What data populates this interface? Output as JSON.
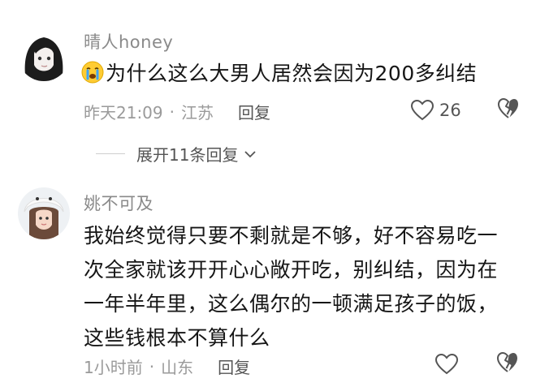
{
  "comments": [
    {
      "username": "晴人honey",
      "emoji": "crying-face-emoji",
      "text": "为什么这么大男人居然会因为200多纠结",
      "time": "昨天21:09",
      "location": "江苏",
      "reply_label": "回复",
      "likes": "26",
      "expand_label": "展开11条回复"
    },
    {
      "username": "姚不可及",
      "text_lines": [
        "我始终觉得只要不剩就是不够，好不容易吃一",
        "次全家就该开开心心敞开吃，别纠结，因为在",
        "一年半年里，这么偶尔的一顿满足孩子的饭，",
        "这些钱根本不算什么"
      ],
      "time": "1小时前",
      "location": "山东",
      "reply_label": "回复",
      "likes": ""
    }
  ],
  "separator": "·",
  "colors": {
    "text": "#161616",
    "meta": "#9a9a9a",
    "username": "#8a8a8a"
  }
}
